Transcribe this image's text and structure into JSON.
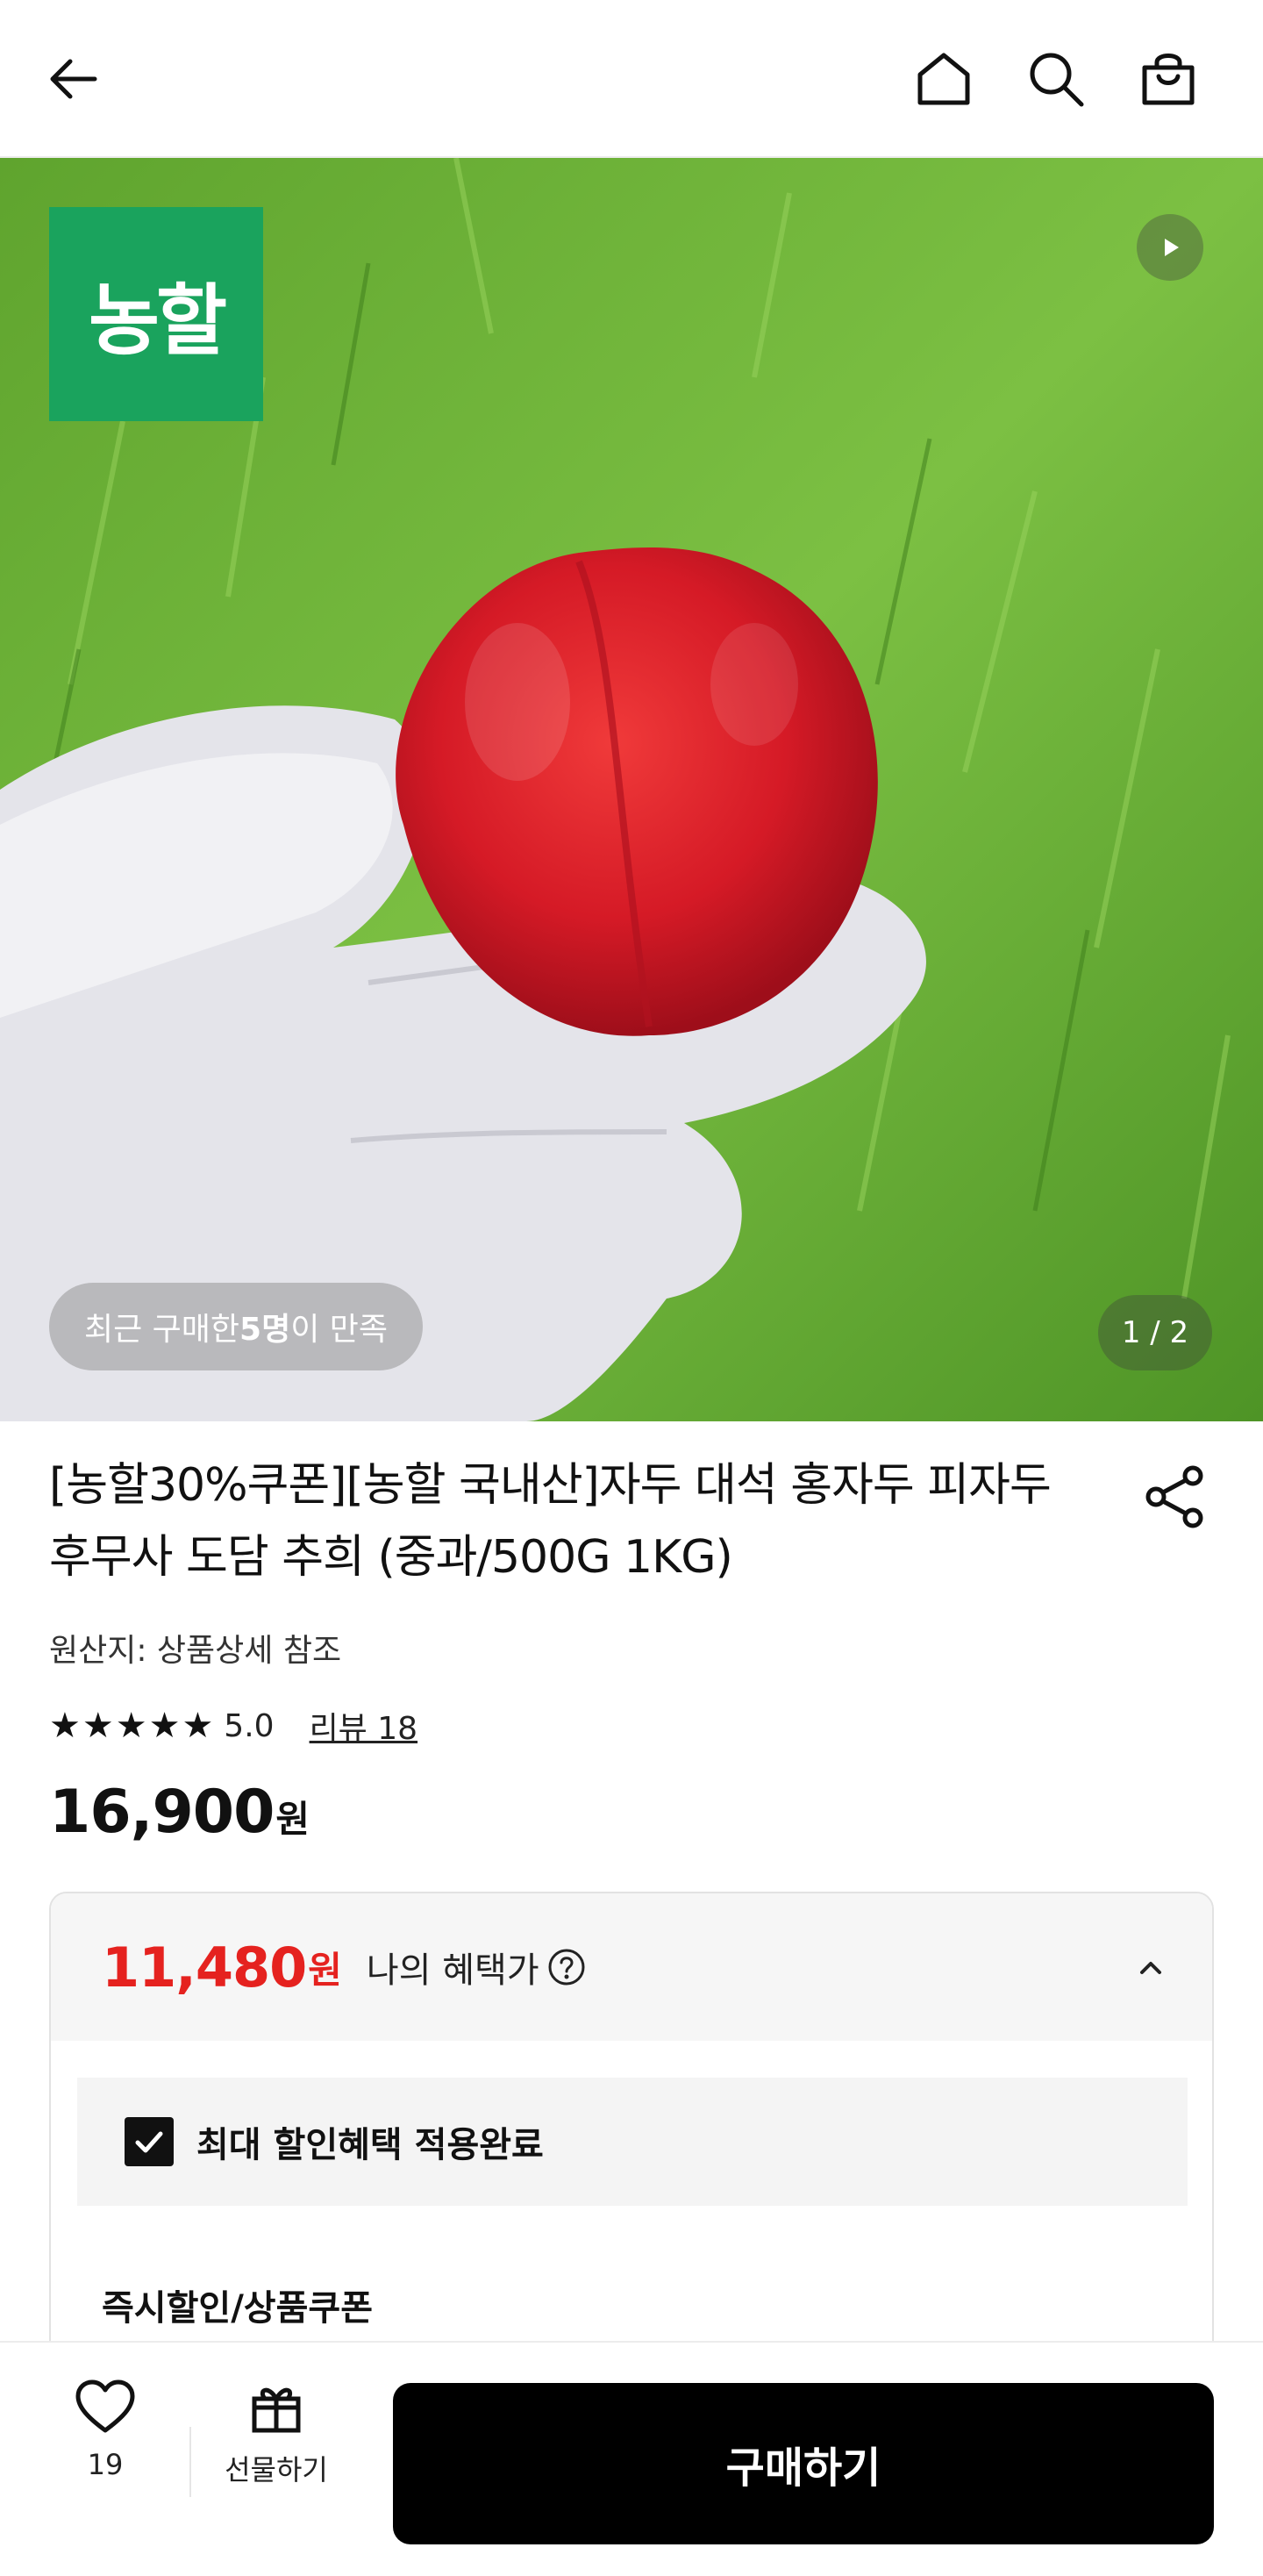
{
  "header": {
    "icons": [
      "arrow-left-icon",
      "home-icon",
      "search-icon",
      "shopping-bag-icon"
    ]
  },
  "hero": {
    "brand": "농할",
    "satisfaction_prefix": "최근 구매한 ",
    "satisfaction_count": "5명",
    "satisfaction_suffix": "이 만족",
    "pager": "1 / 2"
  },
  "product": {
    "title": "[농할30%쿠폰][농할 국내산]자두 대석 홍자두 피자두 후무사 도담 추희 (중과/500G 1KG)",
    "origin": "원산지: 상품상세 참조",
    "rating_value": "5.0",
    "rating_stars": 5,
    "review_link": "리뷰 18",
    "price": "16,900",
    "price_unit": "원"
  },
  "benefit": {
    "price": "11,480",
    "price_unit": "원",
    "label": "나의 혜택가",
    "applied_label": "최대 할인혜택 적용완료",
    "section_label": "즉시할인/상품쿠폰"
  },
  "bottom": {
    "like_count": "19",
    "gift_label": "선물하기",
    "buy_label": "구매하기"
  },
  "colors": {
    "accent_red": "#e5221f",
    "brand_green": "#1aa35d",
    "buy_button": "#000000"
  }
}
